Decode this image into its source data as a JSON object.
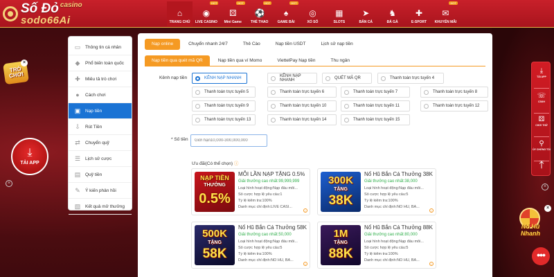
{
  "brand": {
    "logo_main": "Số Đỏ",
    "logo_casino": "casino",
    "logo_sub": "sodo66Ai"
  },
  "nav": [
    {
      "label": "TRANG CHỦ",
      "icon": "home-icon",
      "hot": false,
      "active": true
    },
    {
      "label": "LIVE CASINO",
      "icon": "casino-chip-icon",
      "hot": true,
      "active": false
    },
    {
      "label": "Mini Game",
      "icon": "dice-icon",
      "hot": true,
      "active": false
    },
    {
      "label": "THỂ THAO",
      "icon": "soccer-icon",
      "hot": true,
      "active": false
    },
    {
      "label": "GAME BÀI",
      "icon": "cards-icon",
      "hot": true,
      "active": false
    },
    {
      "label": "XỔ SỐ",
      "icon": "lottery-icon",
      "hot": false,
      "active": false
    },
    {
      "label": "SLOTS",
      "icon": "slot-icon",
      "hot": false,
      "active": false
    },
    {
      "label": "BẮN CÁ",
      "icon": "fish-icon",
      "hot": false,
      "active": false
    },
    {
      "label": "ĐÁ GÀ",
      "icon": "rooster-icon",
      "hot": false,
      "active": false
    },
    {
      "label": "E-SPORT",
      "icon": "gamepad-icon",
      "hot": false,
      "active": false
    },
    {
      "label": "KHUYẾN MÃI",
      "icon": "gift-icon",
      "hot": true,
      "active": false
    }
  ],
  "hot_label": "HOT",
  "side_menu": [
    {
      "label": "Thông tin cá nhân",
      "icon": "id-card-icon",
      "active": false
    },
    {
      "label": "Phổ biến toàn quốc",
      "icon": "diamond-icon",
      "active": false
    },
    {
      "label": "Miêu tả trò chơi",
      "icon": "gamepad-icon",
      "active": false
    },
    {
      "label": "Cách chơi",
      "icon": "circle-icon",
      "active": false
    },
    {
      "label": "Nạp tiền",
      "icon": "wallet-icon",
      "active": true
    },
    {
      "label": "Rút Tiền",
      "icon": "withdraw-icon",
      "active": false
    },
    {
      "label": "Chuyển quỹ",
      "icon": "transfer-icon",
      "active": false
    },
    {
      "label": "Lịch sử cược",
      "icon": "history-icon",
      "active": false
    },
    {
      "label": "Quỹ tiền",
      "icon": "fund-icon",
      "active": false
    },
    {
      "label": "Ý kiến phản hồi",
      "icon": "feedback-icon",
      "active": false
    },
    {
      "label": "Kết quả mở thưởng",
      "icon": "result-icon",
      "active": false
    }
  ],
  "tabs_primary": [
    {
      "label": "Nạp online",
      "active": true
    },
    {
      "label": "Chuyển nhanh 24/7",
      "active": false
    },
    {
      "label": "Thẻ Cào",
      "active": false
    },
    {
      "label": "Nạp tiền USDT",
      "active": false
    },
    {
      "label": "Lịch sử nạp tiền",
      "active": false
    }
  ],
  "tabs_secondary": [
    {
      "label": "Nạp tiền qua quét mã QR",
      "active": true
    },
    {
      "label": "Nạp tiền qua ví Momo",
      "active": false
    },
    {
      "label": "ViettelPay Nạp tiền",
      "active": false
    },
    {
      "label": "Thu ngân",
      "active": false
    }
  ],
  "channel_label": "Kênh nạp tiền",
  "channels": [
    {
      "label": "KÊNH NẠP NHANH",
      "selected": true
    },
    {
      "label": "KÊNH NẠP NHANH",
      "selected": false
    },
    {
      "label": "QUÉT MÃ QR",
      "selected": false
    },
    {
      "label": "Thanh toán trực tuyến 4",
      "selected": false
    },
    {
      "label": "Thanh toán trực tuyến 5",
      "selected": false
    },
    {
      "label": "Thanh toán trực tuyến 6",
      "selected": false
    },
    {
      "label": "Thanh toán trực tuyến 7",
      "selected": false
    },
    {
      "label": "Thanh toán trực tuyến 8",
      "selected": false
    },
    {
      "label": "Thanh toán trực tuyến 9",
      "selected": false
    },
    {
      "label": "Thanh toán trực tuyến 10",
      "selected": false
    },
    {
      "label": "Thanh toán trực tuyến 11",
      "selected": false
    },
    {
      "label": "Thanh toán trực tuyến 12",
      "selected": false
    },
    {
      "label": "Thanh toán trực tuyến 13",
      "selected": false
    },
    {
      "label": "Thanh toán trực tuyến 14",
      "selected": false
    },
    {
      "label": "Thanh toán trực tuyến 15",
      "selected": false
    }
  ],
  "amount": {
    "label": "* Số tiền",
    "placeholder": "Giới hạn10,000-300,000,000"
  },
  "promo_label": "Ưu đãi(Có thể chọn)",
  "promos": [
    {
      "title": "MỖI LẦN NẠP TẶNG 0.5%",
      "max": "Giải thưởng cao nhất:99,999,999",
      "lines": [
        "Loại hình hoạt động:Nạp đầu mỗi...",
        "Số cược hợp lệ yêu cầu:1",
        "Tỷ lệ kiểm tra:100%",
        "Danh mục chỉ định:LIVE CASI..."
      ],
      "img_top": "NẠP TIỀN",
      "img_mid": "THƯỞNG",
      "img_big": "0.5%",
      "colors": {
        "bg1": "#c9151d",
        "bg2": "#7a0a0e"
      }
    },
    {
      "title": "Nổ Hũ Bắn Cá Thưởng 38K",
      "max": "Giải thưởng cao nhất:38,000",
      "lines": [
        "Loại hình hoạt động:Nạp đầu mỗi...",
        "Số cược hợp lệ yêu cầu:5",
        "Tỷ lệ kiểm tra:100%",
        "Danh mục chỉ định:NỔ HŨ, BẮ..."
      ],
      "img_top": "300K",
      "img_mid": "TẶNG",
      "img_big": "38K",
      "colors": {
        "bg1": "#1d5fd0",
        "bg2": "#0a2a6a"
      }
    },
    {
      "title": "Nổ Hũ Bắn Cá Thưởng 58K",
      "max": "Giải thưởng cao nhất:50,000",
      "lines": [
        "Loại hình hoạt động:Nạp đầu mỗi...",
        "Số cược hợp lệ yêu cầu:5",
        "Tỷ lệ kiểm tra:100%",
        "Danh mục chỉ định:NỔ HŨ, BẮ..."
      ],
      "img_top": "500K",
      "img_mid": "TẶNG",
      "img_big": "58K",
      "colors": {
        "bg1": "#2a2a6a",
        "bg2": "#0b0b2a"
      }
    },
    {
      "title": "Nổ Hũ Bắn Cá Thưởng 88K",
      "max": "Giải thưởng cao nhất:80,000",
      "lines": [
        "Loại hình hoạt động:Nạp đầu mỗi...",
        "Số cược hợp lệ yêu cầu:5",
        "Tỷ lệ kiểm tra:100%",
        "Danh mục chỉ định:NỔ HŨ, BẮ..."
      ],
      "img_top": "1M",
      "img_mid": "TẶNG",
      "img_big": "88K",
      "colors": {
        "bg1": "#3a1a5a",
        "bg2": "#10062a"
      }
    }
  ],
  "floaters": {
    "tro_choi": "TRÒ CHƠI",
    "tai_app": "TẢI APP",
    "no_hu": "Nổ Hũ Nhanh",
    "more": "•••"
  },
  "right_panel": [
    {
      "label": "TẢI APP",
      "icon": "download-icon"
    },
    {
      "label": "CSKH",
      "icon": "support-icon"
    },
    {
      "label": "CHƠI THỬ",
      "icon": "dice-icon"
    },
    {
      "label": "ỦY CHỨNG TỐI",
      "icon": "link-icon"
    },
    {
      "label": "",
      "icon": "arrow-up-icon"
    }
  ],
  "colors": {
    "brand_red": "#c8202a",
    "accent_orange": "#f59a23",
    "active_blue": "#1a73d4",
    "promo_green": "#2fae4a",
    "gold": "#f3d27a"
  }
}
